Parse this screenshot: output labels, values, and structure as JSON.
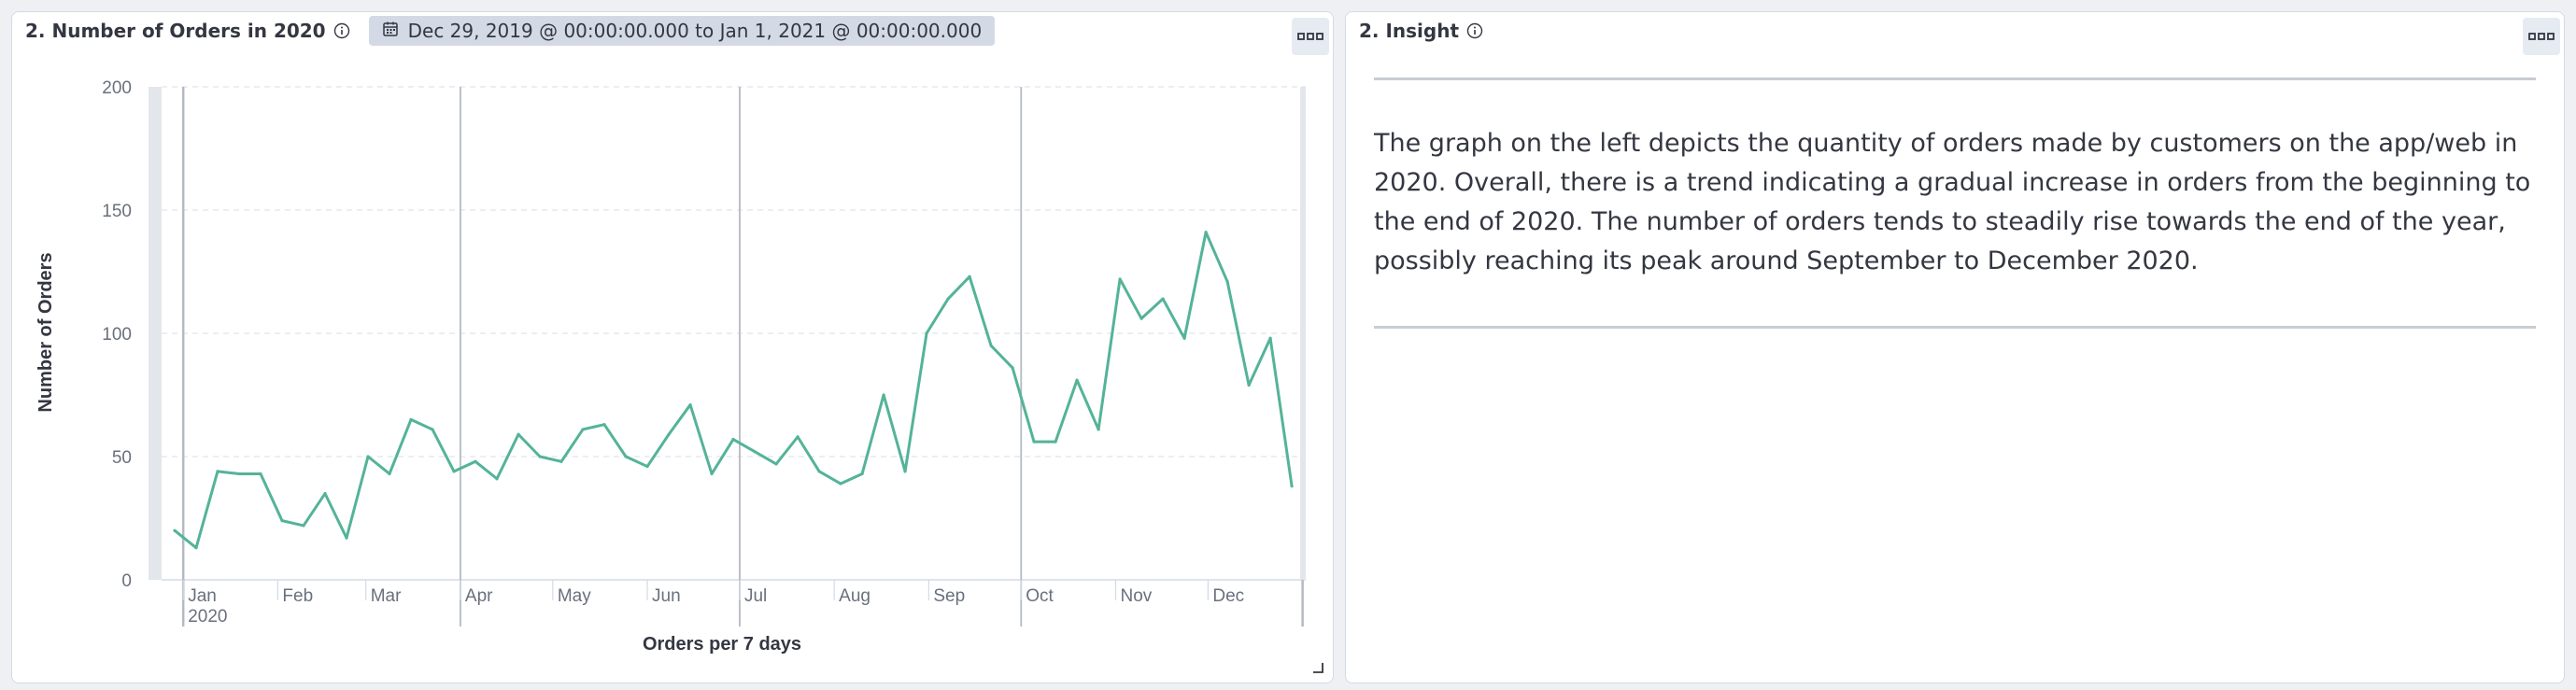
{
  "left_panel": {
    "title": "2. Number of Orders in 2020",
    "time_range": "Dec 29, 2019 @ 00:00:00.000 to Jan 1, 2021 @ 00:00:00.000"
  },
  "right_panel": {
    "title": "2. Insight",
    "text": "The graph on the left depicts the quantity of orders made by customers on the app/web in 2020. Overall, there is a trend indicating a gradual increase in orders from the beginning to the end of 2020. The number of orders tends to steadily rise towards the end of the year, possibly reaching its peak around September to December 2020."
  },
  "chart_data": {
    "type": "line",
    "xlabel": "Orders per 7 days",
    "ylabel": "Number of Orders",
    "ylim": [
      0,
      200
    ],
    "y_ticks": [
      0,
      50,
      100,
      150,
      200
    ],
    "x_ticks": [
      {
        "label": "Jan",
        "sublabel": "2020",
        "week": 0.4
      },
      {
        "label": "Feb",
        "week": 4.8
      },
      {
        "label": "Mar",
        "week": 8.9
      },
      {
        "label": "Apr",
        "week": 13.3
      },
      {
        "label": "May",
        "week": 17.6
      },
      {
        "label": "Jun",
        "week": 22
      },
      {
        "label": "Jul",
        "week": 26.3
      },
      {
        "label": "Aug",
        "week": 30.7
      },
      {
        "label": "Sep",
        "week": 35.1
      },
      {
        "label": "Oct",
        "week": 39.4
      },
      {
        "label": "Nov",
        "week": 43.8
      },
      {
        "label": "Dec",
        "week": 48.1
      }
    ],
    "quarter_lines_week": [
      0.4,
      13.3,
      26.3,
      39.4,
      52.5
    ],
    "grid": true,
    "line_color": "#54b399",
    "series": [
      {
        "values": [
          20,
          13,
          44,
          43,
          43,
          24,
          22,
          35,
          17,
          50,
          43,
          65,
          61,
          44,
          48,
          41,
          59,
          50,
          48,
          61,
          63,
          50,
          46,
          59,
          71,
          43,
          57,
          52,
          47,
          58,
          44,
          39,
          43,
          75,
          44,
          100,
          114,
          123,
          95,
          86,
          56,
          56,
          81,
          61,
          122,
          106,
          114,
          98,
          141,
          121,
          79,
          98,
          38
        ]
      }
    ]
  }
}
